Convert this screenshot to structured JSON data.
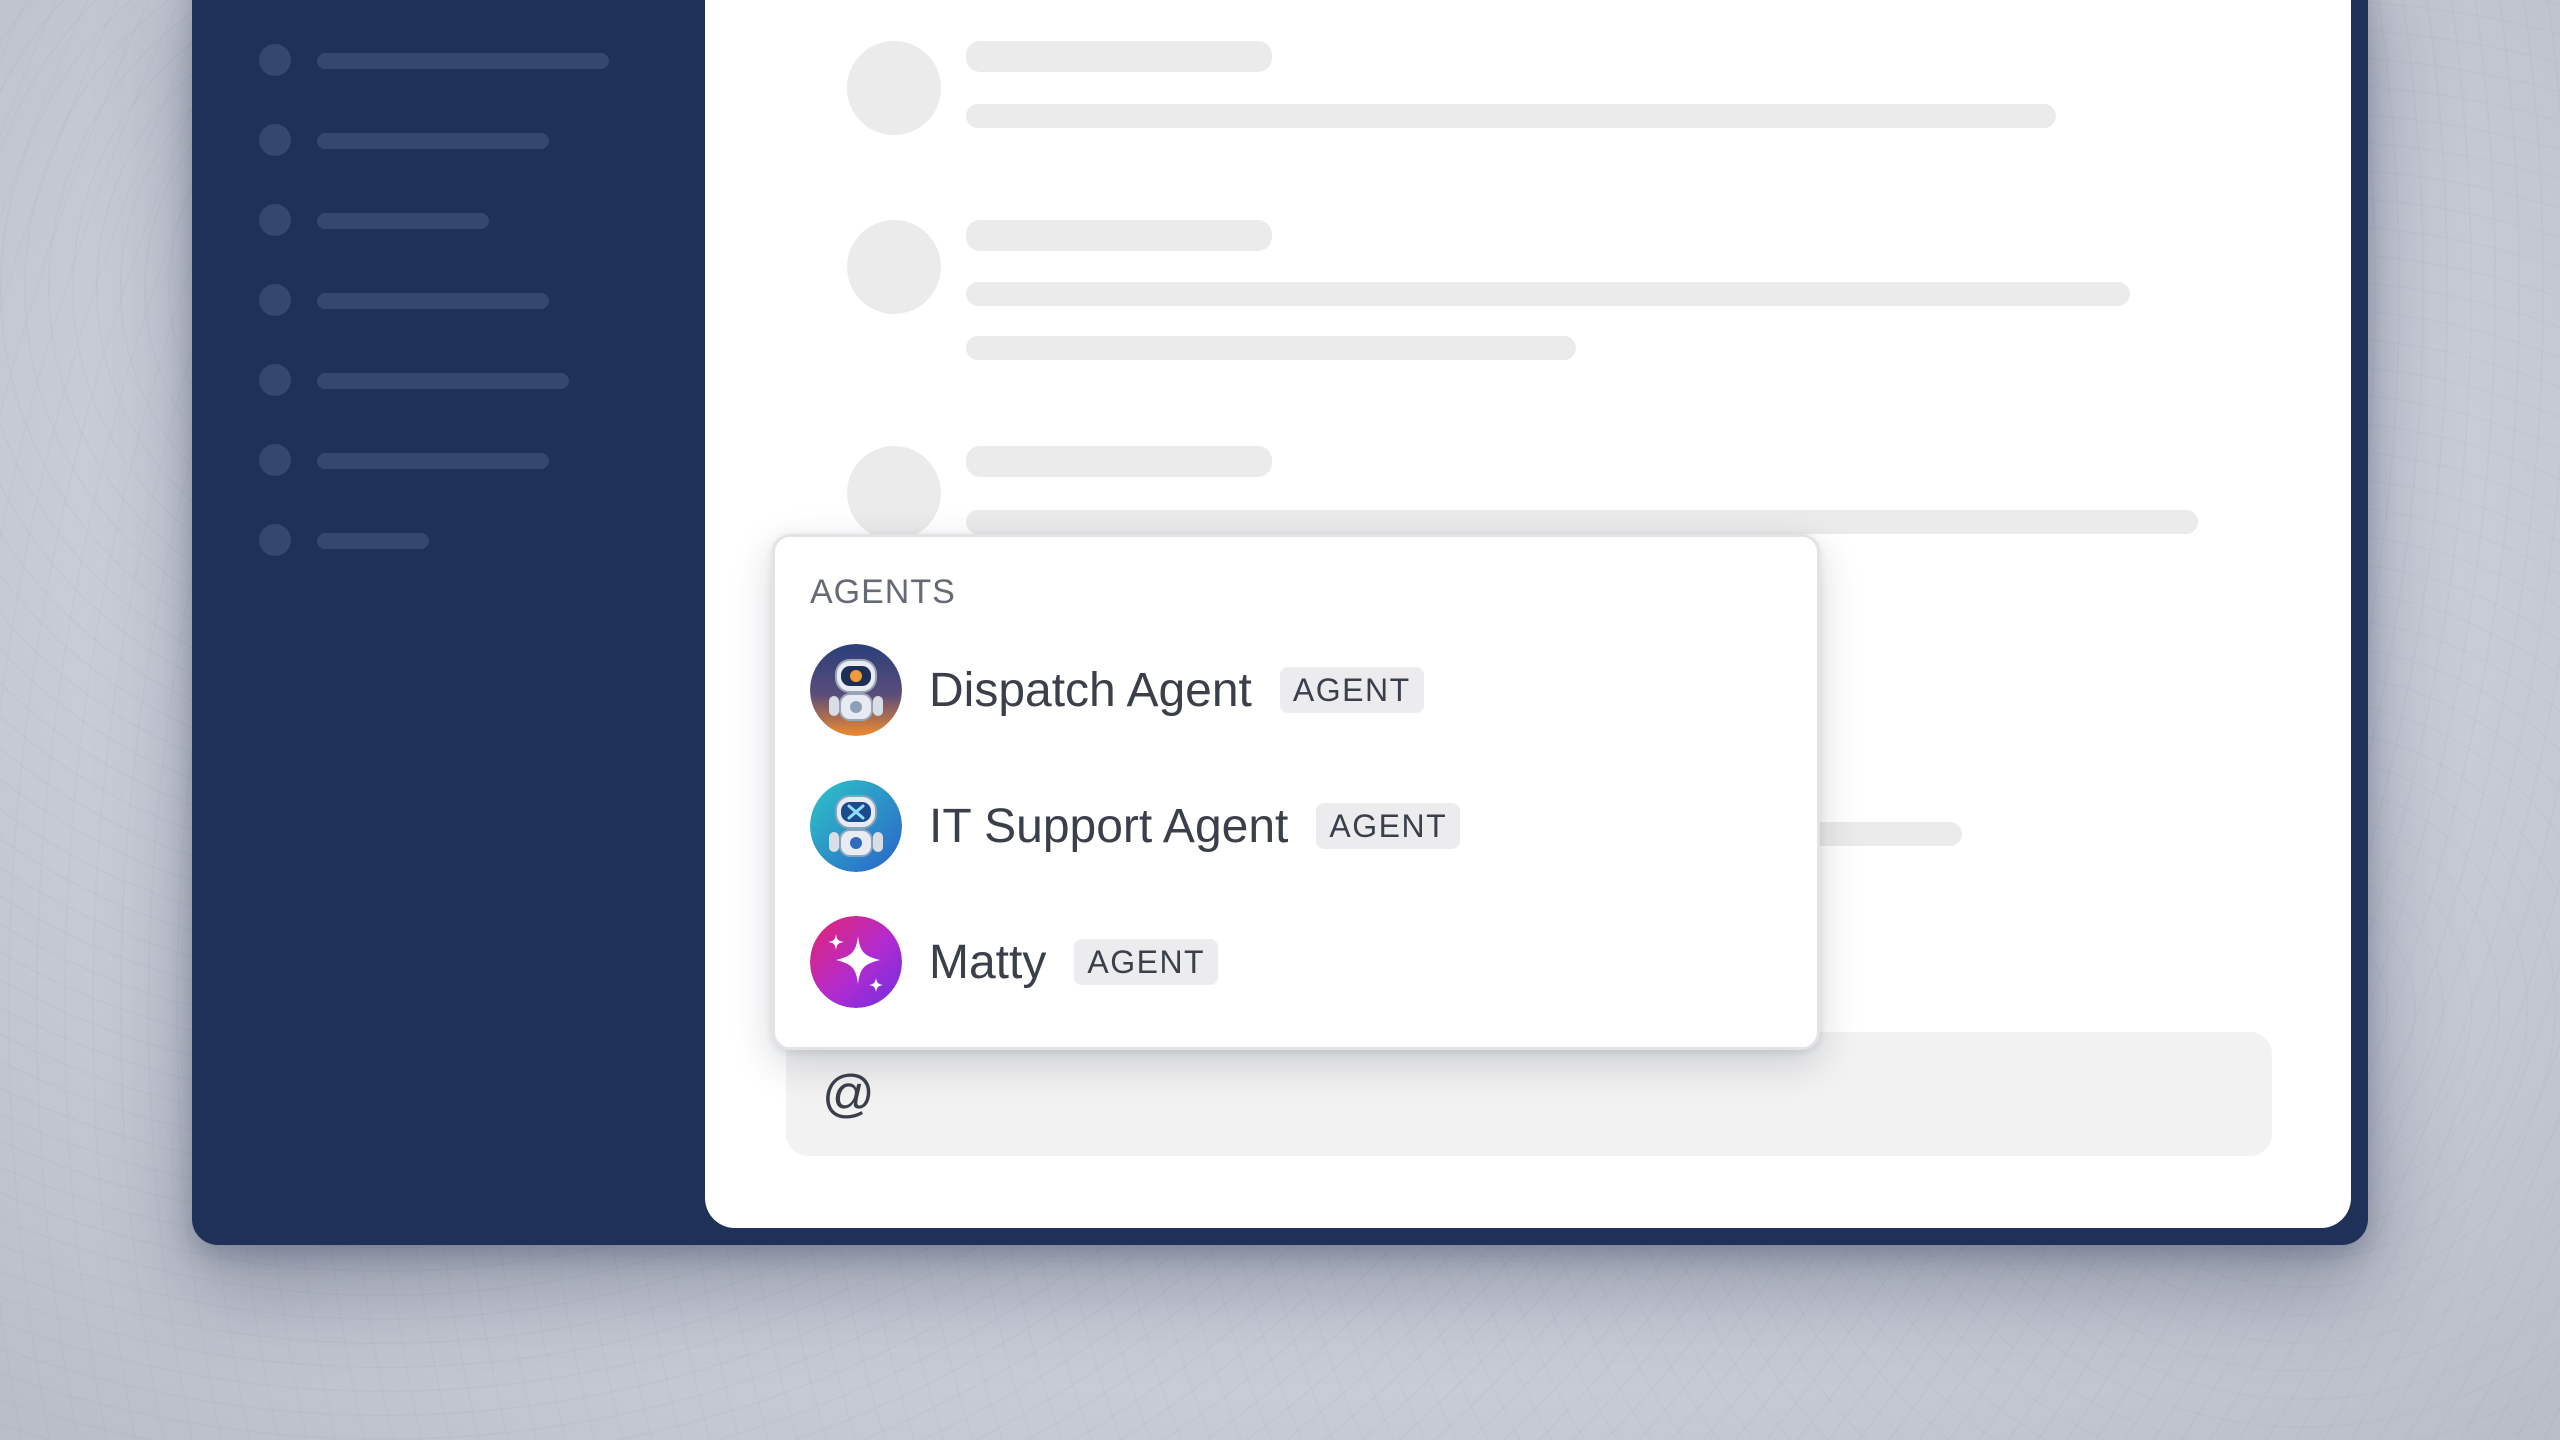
{
  "mention_popup": {
    "section_header": "AGENTS",
    "agents": [
      {
        "name": "Dispatch Agent",
        "badge": "AGENT",
        "icon": "robot-dispatch-icon"
      },
      {
        "name": "IT Support Agent",
        "badge": "AGENT",
        "icon": "robot-it-support-icon"
      },
      {
        "name": "Matty",
        "badge": "AGENT",
        "icon": "sparkle-icon"
      }
    ]
  },
  "composer": {
    "value": "@"
  },
  "colors": {
    "sidebar": "#1f3158",
    "accent_dispatch": "#e9853a",
    "accent_it_support": "#3aa0dd",
    "accent_matty": "#b02ad0"
  }
}
